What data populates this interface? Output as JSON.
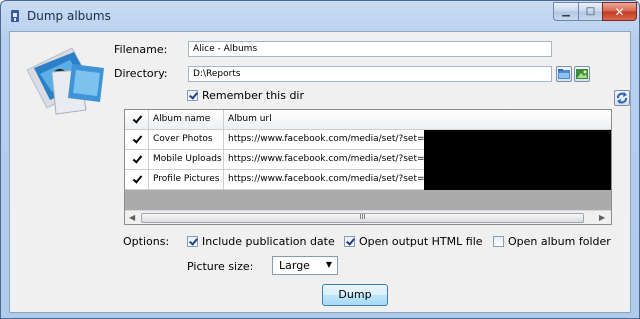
{
  "window": {
    "title": "Dump albums",
    "minimize_glyph": "▁",
    "maximize_glyph": "□",
    "close_glyph": "✕"
  },
  "form": {
    "filename_label": "Filename:",
    "filename_value": "Alice - Albums",
    "directory_label": "Directory:",
    "directory_value": "D:\\Reports",
    "remember_dir_label": "Remember this dir",
    "remember_dir_checked": true
  },
  "grid": {
    "headers": [
      "",
      "Album name",
      "Album url"
    ],
    "rows": [
      {
        "checked": true,
        "name": "Cover Photos",
        "url": "https://www.facebook.com/media/set/?set="
      },
      {
        "checked": true,
        "name": "Mobile Uploads",
        "url": "https://www.facebook.com/media/set/?set="
      },
      {
        "checked": true,
        "name": "Profile Pictures",
        "url": "https://www.facebook.com/media/set/?set="
      }
    ],
    "header_checked": true,
    "scroll_thumb_grip": "III",
    "scroll_left_glyph": "◀",
    "scroll_right_glyph": "▶"
  },
  "options": {
    "label": "Options:",
    "include_date_label": "Include publication date",
    "include_date_checked": true,
    "open_html_label": "Open output HTML file",
    "open_html_checked": true,
    "open_folder_label": "Open album folder",
    "open_folder_checked": false
  },
  "picture_size": {
    "label": "Picture size:",
    "value": "Large"
  },
  "actions": {
    "dump_label": "Dump"
  },
  "icons": {
    "app": "facebook-photo-icon",
    "hero": "photo-albums-icon",
    "browse": "folder-open-icon",
    "browse_alt": "image-folder-icon",
    "refresh": "refresh-icon"
  },
  "colors": {
    "titlebar": "#b7cfee",
    "client_bg": "#f0f0f0",
    "close_red": "#c23a22",
    "button_blue": "#bee6fd"
  }
}
